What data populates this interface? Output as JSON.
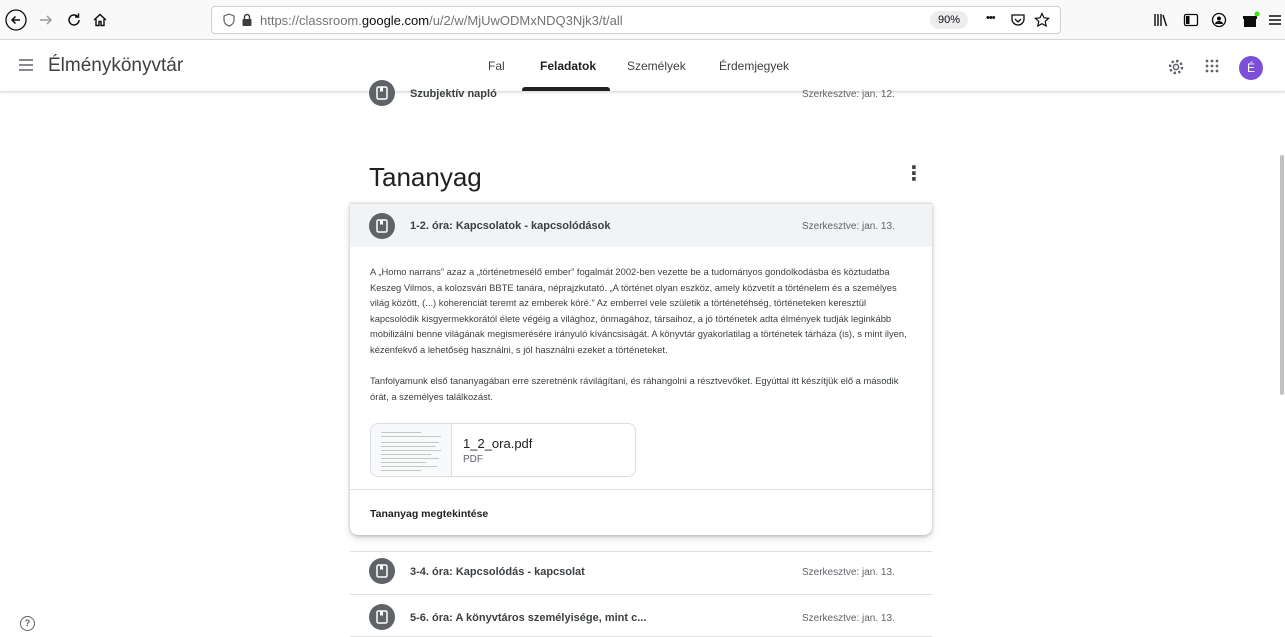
{
  "browser": {
    "url_prefix": "https://classroom.",
    "url_domain": "google.com",
    "url_suffix": "/u/2/w/MjUwODMxNDQ3Njk3/t/all",
    "zoom": "90%",
    "menu_dots": "•••"
  },
  "header": {
    "class_title": "Élménykönyvtár",
    "tabs": [
      {
        "label": "Fal"
      },
      {
        "label": "Feladatok"
      },
      {
        "label": "Személyek"
      },
      {
        "label": "Érdemjegyek"
      }
    ],
    "avatar_letter": "É"
  },
  "top_item": {
    "title": "Szubjektív napló",
    "edited": "Szerkesztve: jan. 12."
  },
  "section": {
    "title": "Tananyag",
    "more_icon": "⋮"
  },
  "card": {
    "title": "1-2. óra: Kapcsolatok - kapcsolódások",
    "edited": "Szerkesztve: jan. 13.",
    "paragraph1": "A „Homo narrans” azaz a „történetmesélő ember” fogalmát 2002-ben vezette be a tudományos gondolkodásba és köztudatba Keszeg Vilmos, a kolozsvári BBTE tanára, néprajzkutató. „A történet olyan eszköz, amely közvetít a történelem és a személyes világ között, (...) koherenciát teremt az emberek köré.” Az emberrel vele születik a történetéhség, történeteken keresztül kapcsolódik kisgyermekkorától élete végéig a világhoz, önmagához, társaihoz, a jó történetek adta élmények tudják leginkább mobilizálni benne világának megismerésére irányuló kíváncsiságát. A könyvtár gyakorlatilag a történetek tárháza (is), s mint ilyen, kézenfekvő a lehetőség használni, s jól használni ezeket a történeteket.",
    "paragraph2": "Tanfolyamunk első tananyagában erre szeretnénk rávilágítani, és ráhangolni a résztvevőket. Egyúttal itt készítjük elő a második órát, a személyes találkozást.",
    "attachment": {
      "name": "1_2_ora.pdf",
      "type": "PDF"
    },
    "footer_link": "Tananyag megtekintése"
  },
  "items": [
    {
      "title": "3-4. óra: Kapcsolódás - kapcsolat",
      "edited": "Szerkesztve: jan. 13."
    },
    {
      "title": "5-6. óra: A könyvtáros személyisége, mint c...",
      "edited": "Szerkesztve: jan. 13."
    }
  ],
  "help_icon": "?"
}
